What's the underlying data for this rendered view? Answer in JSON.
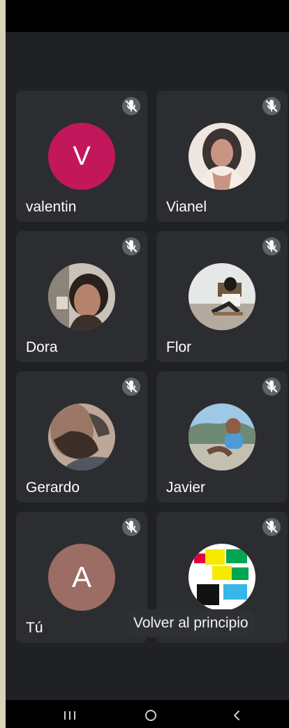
{
  "meeting": {
    "participants": [
      {
        "name": "valentin",
        "avatar_type": "initial",
        "initial": "V",
        "avatar_color": "#c2185b",
        "muted": true
      },
      {
        "name": "Vianel",
        "avatar_type": "photo",
        "muted": true
      },
      {
        "name": "Dora",
        "avatar_type": "photo",
        "muted": true
      },
      {
        "name": "Flor",
        "avatar_type": "photo",
        "muted": true
      },
      {
        "name": "Gerardo",
        "avatar_type": "photo",
        "muted": true
      },
      {
        "name": "Javier",
        "avatar_type": "photo",
        "muted": true
      },
      {
        "name": "Tú",
        "avatar_type": "initial",
        "initial": "A",
        "avatar_color": "#9b6d64",
        "muted": true
      },
      {
        "name": "",
        "avatar_type": "photo",
        "muted": true
      }
    ],
    "tooltip": "Volver al principio",
    "muted_icon": "mic-off-icon",
    "colors": {
      "background": "#202124",
      "tile": "#2c2d30",
      "text": "#ffffff"
    }
  },
  "system_nav": {
    "recents_icon": "recents-icon",
    "home_icon": "home-icon",
    "back_icon": "back-icon"
  }
}
